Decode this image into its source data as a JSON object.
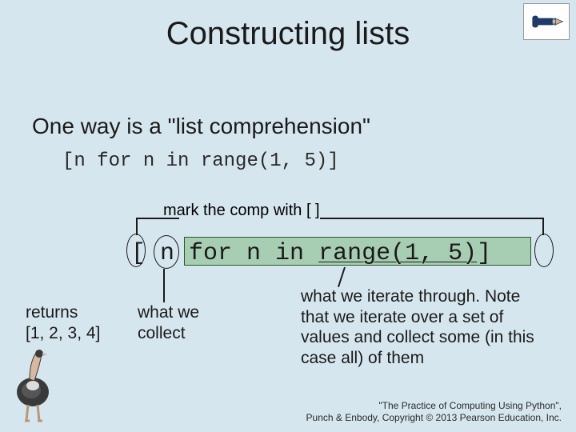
{
  "title": "Constructing lists",
  "subtitle": "One way is a \"list comprehension\"",
  "code_line_1": "[n for n in range(1, 5)]",
  "comp_label": "mark the comp with [ ]",
  "big_code": {
    "l_bracket": "[",
    "collect": " n ",
    "for_part": "for n in ",
    "iter": "range(1, 5)",
    "r_bracket": "]"
  },
  "returns": {
    "l1": "returns",
    "l2": "[1, 2, 3, 4]"
  },
  "collect_label": {
    "l1": "what we",
    "l2": "collect"
  },
  "iter_label": "what we iterate through. Note that we iterate over a set of values and collect some (in this case all) of them",
  "footer": {
    "l1": "\"The Practice of Computing Using Python\",",
    "l2": "Punch & Enbody, Copyright © 2013 Pearson Education, Inc."
  }
}
